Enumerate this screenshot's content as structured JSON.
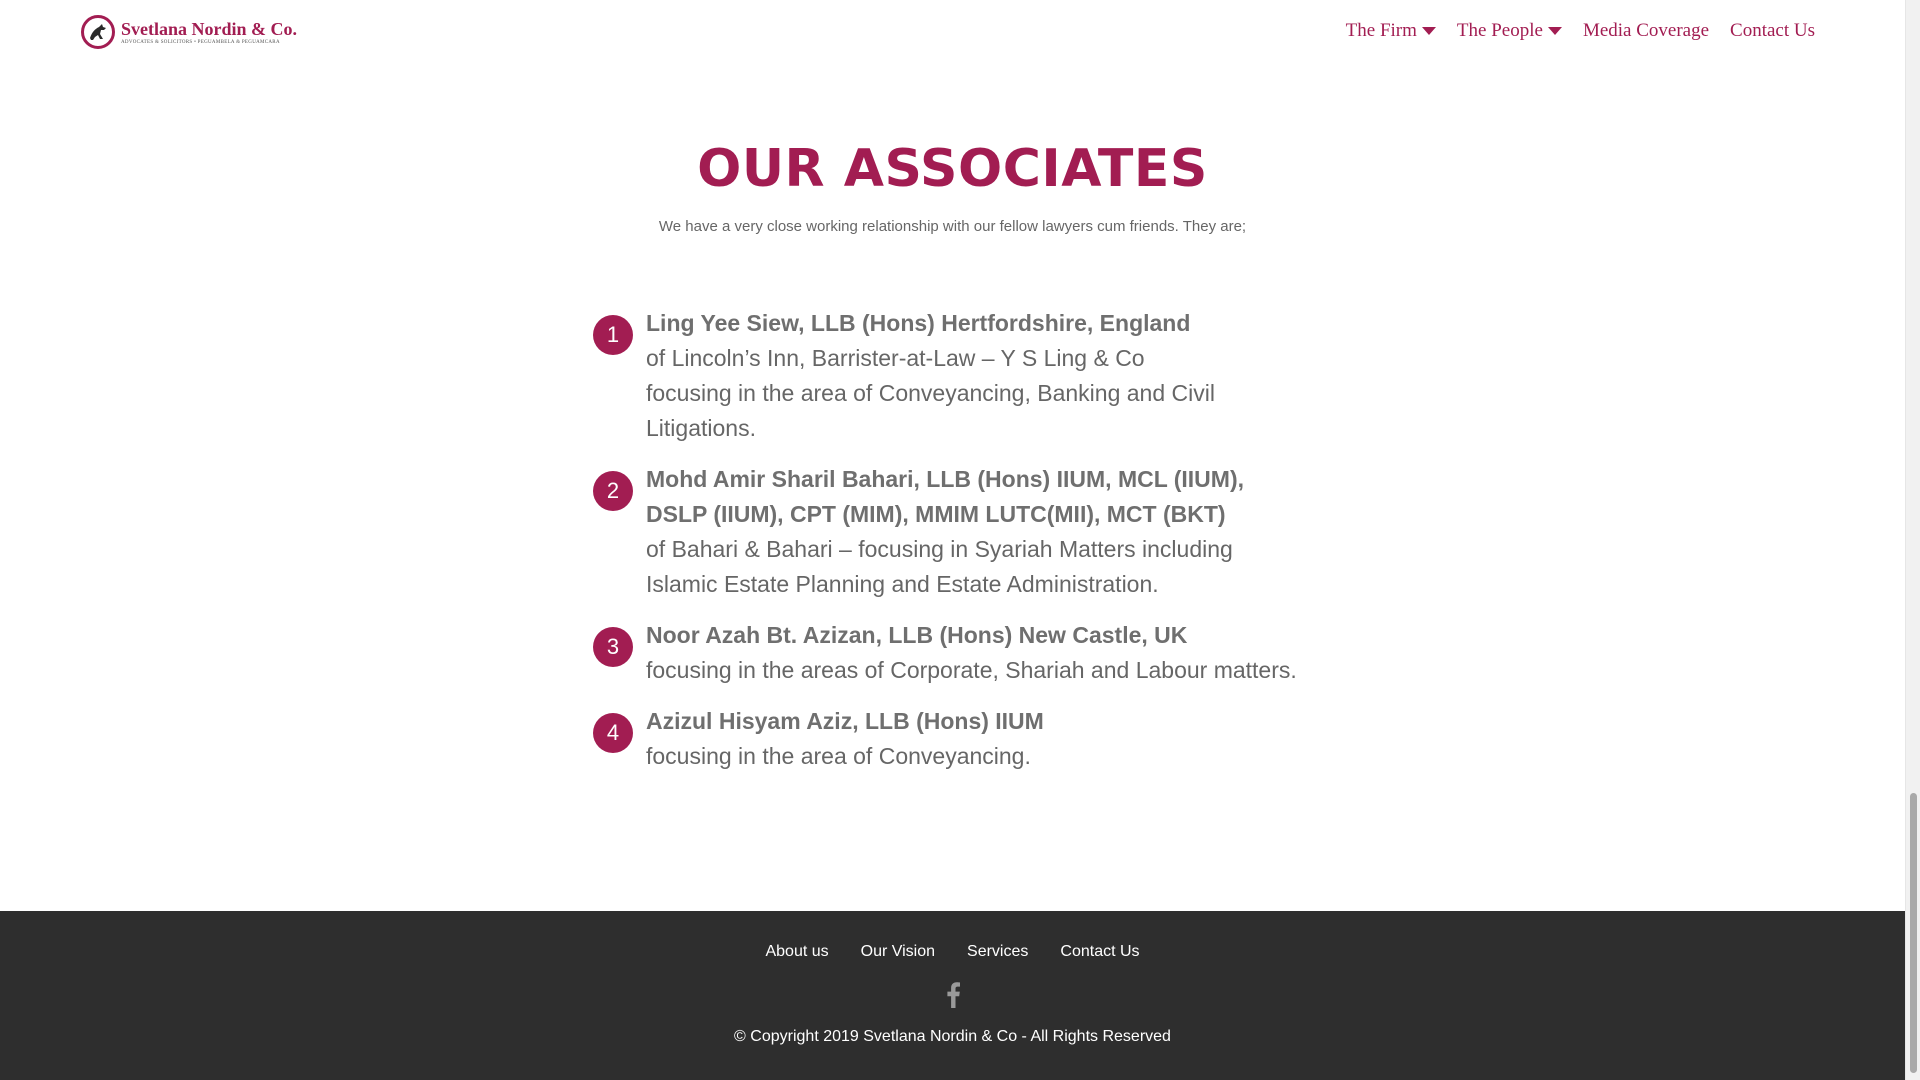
{
  "header": {
    "logo": {
      "name": "Svetlana Nordin & Co.",
      "subtitle": "ADVOCATES & SOLICITORS • PEGUAMBELA & PEGUAMCARA"
    },
    "nav": [
      {
        "label": "The Firm",
        "dropdown": true
      },
      {
        "label": "The People",
        "dropdown": true
      },
      {
        "label": "Media Coverage",
        "dropdown": false
      },
      {
        "label": "Contact Us",
        "dropdown": false
      }
    ]
  },
  "main": {
    "title": "OUR ASSOCIATES",
    "subtitle": "We have a very close working relationship with our fellow lawyers cum friends. They are;",
    "associates": [
      {
        "number": "1",
        "name": "Ling Yee Siew, LLB (Hons) Hertfordshire, England",
        "lines": [
          "of Lincoln’s Inn, Barrister-at-Law – Y S Ling & Co",
          "focusing in the area of Conveyancing, Banking and Civil Litigations."
        ]
      },
      {
        "number": "2",
        "name": "Mohd Amir Sharil Bahari, LLB (Hons) IIUM, MCL (IIUM), DSLP (IIUM), CPT (MIM), MMIM LUTC(MII), MCT (BKT)",
        "lines": [
          "of Bahari & Bahari – focusing in Syariah Matters including Islamic Estate Planning and Estate Administration."
        ]
      },
      {
        "number": "3",
        "name": "Noor Azah Bt. Azizan, LLB (Hons) New Castle, UK",
        "lines": [
          "focusing in the areas of Corporate, Shariah and Labour matters."
        ]
      },
      {
        "number": "4",
        "name": "Azizul Hisyam Aziz, LLB (Hons) IIUM",
        "lines": [
          "focusing in the area of Conveyancing."
        ]
      }
    ]
  },
  "footer": {
    "links": [
      "About us",
      "Our Vision",
      "Services",
      "Contact Us"
    ],
    "social_icon": "facebook-icon",
    "copyright": "© Copyright 2019 Svetlana Nordin & Co - All Rights Reserved"
  },
  "colors": {
    "brand": "#a21d52",
    "text": "#666666",
    "footer_bg": "#2e2e2e"
  }
}
